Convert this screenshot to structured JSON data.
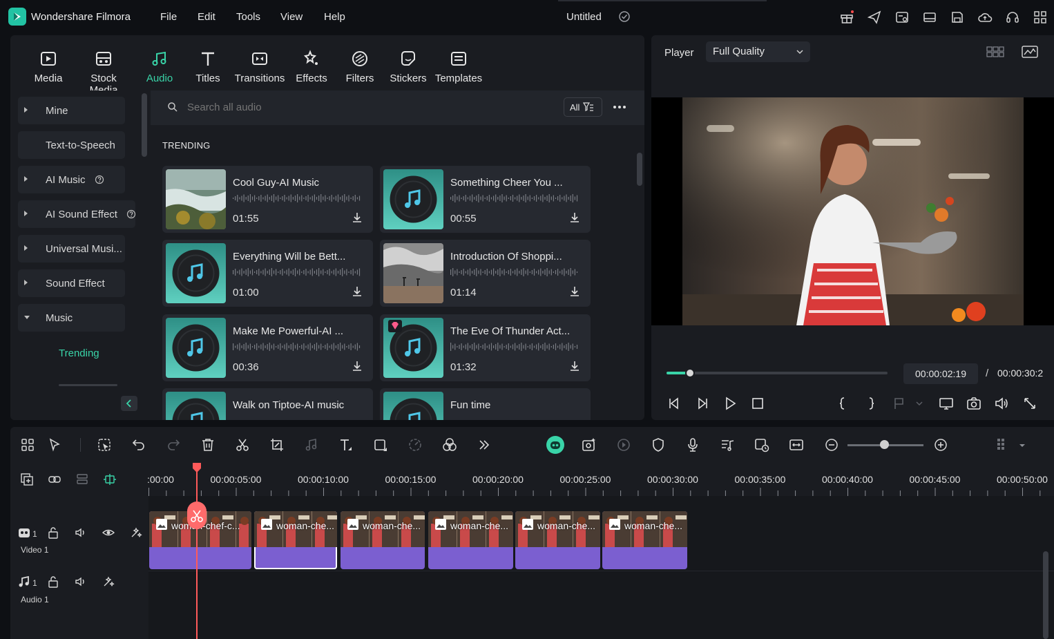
{
  "app": {
    "name": "Wondershare Filmora",
    "doc_title": "Untitled"
  },
  "menu": [
    "File",
    "Edit",
    "Tools",
    "View",
    "Help"
  ],
  "library_tabs": [
    {
      "label": "Media",
      "icon": "media-icon"
    },
    {
      "label": "Stock Media",
      "icon": "stock-media-icon"
    },
    {
      "label": "Audio",
      "icon": "audio-icon",
      "active": true
    },
    {
      "label": "Titles",
      "icon": "titles-icon"
    },
    {
      "label": "Transitions",
      "icon": "transitions-icon"
    },
    {
      "label": "Effects",
      "icon": "effects-icon"
    },
    {
      "label": "Filters",
      "icon": "filters-icon"
    },
    {
      "label": "Stickers",
      "icon": "stickers-icon"
    },
    {
      "label": "Templates",
      "icon": "templates-icon"
    }
  ],
  "sidebar": {
    "items": [
      {
        "label": "Mine",
        "expandable": true
      },
      {
        "label": "Text-to-Speech",
        "expandable": false
      },
      {
        "label": "AI Music",
        "expandable": true,
        "help": true
      },
      {
        "label": "AI Sound Effect",
        "expandable": true,
        "help": true
      },
      {
        "label": "Universal Musi...",
        "expandable": true
      },
      {
        "label": "Sound Effect",
        "expandable": true
      },
      {
        "label": "Music",
        "expandable": true,
        "expanded": true
      }
    ],
    "sub_selected": "Trending",
    "accent": "#39d4a8"
  },
  "search": {
    "placeholder": "Search all audio",
    "filter_label": "All"
  },
  "section_title": "TRENDING",
  "tracks": [
    {
      "title": "Cool Guy-AI Music",
      "duration": "01:55",
      "thumb": "landscape"
    },
    {
      "title": "Something Cheer You ...",
      "duration": "00:55",
      "thumb": "music"
    },
    {
      "title": "Everything Will be Bett...",
      "duration": "01:00",
      "thumb": "music"
    },
    {
      "title": "Introduction Of Shoppi...",
      "duration": "01:14",
      "thumb": "landscape-cloudy"
    },
    {
      "title": "Make Me Powerful-AI ...",
      "duration": "00:36",
      "thumb": "music"
    },
    {
      "title": "The Eve Of Thunder Act...",
      "duration": "01:32",
      "thumb": "music",
      "premium": true
    },
    {
      "title": "Walk on Tiptoe-AI music",
      "duration": "",
      "thumb": "music"
    },
    {
      "title": "Fun time",
      "duration": "",
      "thumb": "music"
    }
  ],
  "player": {
    "label": "Player",
    "quality": "Full Quality",
    "current_time": "00:00:02:19",
    "separator": "/",
    "total_time": "00:00:30:2",
    "progress_fraction": 0.107
  },
  "timeline": {
    "ruler_labels": [
      ":00:00",
      "00:00:05:00",
      "00:00:10:00",
      "00:00:15:00",
      "00:00:20:00",
      "00:00:25:00",
      "00:00:30:00",
      "00:00:35:00",
      "00:00:40:00",
      "00:00:45:00",
      "00:00:50:00"
    ],
    "tracks": [
      {
        "label": "Video 1",
        "index": "1"
      },
      {
        "label": "Audio 1",
        "index": "1"
      }
    ],
    "clips": [
      "woman-chef-c...",
      "woman-che...",
      "woman-che...",
      "woman-che...",
      "woman-che...",
      "woman-che..."
    ],
    "clip_color": "#7b5fd0",
    "playhead_color": "#ff5a5a"
  }
}
